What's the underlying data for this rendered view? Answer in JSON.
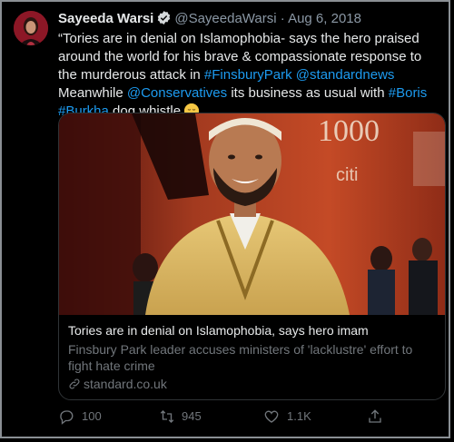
{
  "tweet": {
    "author_name": "Sayeeda Warsi",
    "handle": "@SayeedaWarsi",
    "separator": "·",
    "date": "Aug 6, 2018",
    "text_1": "“Tories are in denial on Islamophobia- says the hero praised around the world for his brave & compassionate response to the murderous attack in ",
    "hashtag_finsbury": "#FinsburyPark",
    "text_2": " ",
    "mention_standard": "@standardnews",
    "text_3": "Meanwhile ",
    "mention_conservatives": "@Conservatives",
    "text_4": " its business as usual with ",
    "hashtag_boris": "#Boris",
    "text_5": " ",
    "hashtag_burkha": "#Burkha",
    "text_6": " dog whistle "
  },
  "card": {
    "title": "Tories are in denial on Islamophobia, says hero imam",
    "description": "Finsbury Park leader accuses ministers of 'lacklustre' effort to fight hate crime",
    "domain": "standard.co.uk",
    "backdrop_text_top": "1000",
    "backdrop_text_brand": "citi"
  },
  "actions": {
    "replies": "100",
    "retweets": "945",
    "likes": "1.1K"
  },
  "colors": {
    "link": "#1d9bf0",
    "muted": "#71767b",
    "background": "#000000"
  }
}
